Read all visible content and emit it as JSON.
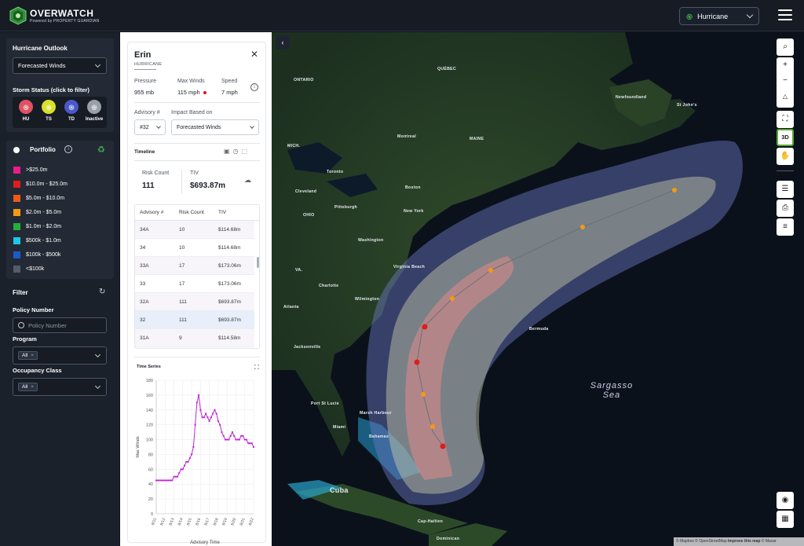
{
  "header": {
    "brand": "OVERWATCH",
    "brand_sub": "Powered by PROPERTY GUARDIAN",
    "hazard": "Hurricane"
  },
  "outlook": {
    "title": "Hurricane Outlook",
    "selected": "Forecasted Winds",
    "status_title": "Storm Status (click to filter)",
    "statuses": [
      {
        "label": "HU",
        "color": "#e05262"
      },
      {
        "label": "TS",
        "color": "#d8e02a"
      },
      {
        "label": "TD",
        "color": "#4a58c8"
      },
      {
        "label": "Inactive",
        "color": "#9aa0a8"
      }
    ]
  },
  "portfolio": {
    "title": "Portfolio",
    "legend": [
      {
        "label": ">$25.0m",
        "color": "#ee1a8c"
      },
      {
        "label": "$10.0m - $25.0m",
        "color": "#e01c1c"
      },
      {
        "label": "$5.0m - $10.0m",
        "color": "#f05a14"
      },
      {
        "label": "$2.0m - $5.0m",
        "color": "#f59a12"
      },
      {
        "label": "$1.0m - $2.0m",
        "color": "#22b03a"
      },
      {
        "label": "$500k - $1.0m",
        "color": "#1cc8e8"
      },
      {
        "label": "$100k - $500k",
        "color": "#1c5ac8"
      },
      {
        "label": "<$100k",
        "color": "#545c68"
      }
    ]
  },
  "filter": {
    "title": "Filter",
    "policy_label": "Policy Number",
    "policy_placeholder": "Policy Number",
    "program_label": "Program",
    "program_chip": "All",
    "occupancy_label": "Occupancy Class",
    "occupancy_chip": "All"
  },
  "storm": {
    "name": "Erin",
    "type": "HURRICANE",
    "pressure_label": "Pressure",
    "pressure": "955 mb",
    "winds_label": "Max Winds",
    "winds": "115 mph",
    "speed_label": "Speed",
    "speed": "7 mph",
    "advisory_label": "Advisory #",
    "advisory": "#32",
    "impact_label": "Impact Based on",
    "impact": "Forecasted Winds",
    "timeline_label": "Timeline",
    "risk_count_label": "Risk Count",
    "risk_count": "111",
    "tiv_label": "TIV",
    "tiv": "$693.87m"
  },
  "table": {
    "headers": [
      "Advisory #",
      "Risk Count",
      "TIV"
    ],
    "rows": [
      [
        "34A",
        "10",
        "$114.68m"
      ],
      [
        "34",
        "10",
        "$114.68m"
      ],
      [
        "33A",
        "17",
        "$173.06m"
      ],
      [
        "33",
        "17",
        "$173.06m"
      ],
      [
        "32A",
        "111",
        "$693.87m"
      ],
      [
        "32",
        "111",
        "$693.87m"
      ],
      [
        "31A",
        "9",
        "$114.58m"
      ]
    ]
  },
  "chart_data": {
    "type": "line",
    "title": "Time Series",
    "xlabel": "Advisory Time",
    "ylabel": "Max Winds",
    "ylim": [
      0,
      180
    ],
    "yticks": [
      0,
      20,
      40,
      60,
      80,
      100,
      120,
      140,
      160,
      180
    ],
    "xticks": [
      "8/11",
      "8/12",
      "8/13",
      "8/14",
      "8/15",
      "8/16",
      "8/17",
      "8/18",
      "8/19",
      "8/20",
      "8/21",
      "8/22"
    ],
    "x": [
      0,
      0.2,
      0.4,
      0.6,
      0.8,
      1.0,
      1.2,
      1.4,
      1.6,
      1.8,
      2.0,
      2.2,
      2.4,
      2.6,
      2.8,
      3.0,
      3.2,
      3.4,
      3.6,
      3.8,
      4.0,
      4.2,
      4.4,
      4.6,
      4.8,
      5.0,
      5.2,
      5.4,
      5.6,
      5.8,
      6.0,
      6.2,
      6.4,
      6.6,
      6.8,
      7.0,
      7.2,
      7.4,
      7.6,
      7.8,
      8.0,
      8.2,
      8.4,
      8.6,
      8.8,
      9.0,
      9.2,
      9.4,
      9.6,
      9.8,
      10.0,
      10.2,
      10.4,
      10.6,
      10.8,
      11.0
    ],
    "values": [
      45,
      45,
      45,
      45,
      45,
      45,
      45,
      45,
      45,
      45,
      50,
      50,
      50,
      55,
      60,
      60,
      65,
      70,
      70,
      75,
      80,
      90,
      120,
      150,
      160,
      140,
      130,
      130,
      135,
      130,
      125,
      130,
      135,
      140,
      135,
      125,
      120,
      110,
      105,
      100,
      100,
      100,
      105,
      110,
      105,
      100,
      100,
      100,
      105,
      105,
      100,
      100,
      95,
      95,
      95,
      90
    ],
    "color": "#c025d8"
  }
}
